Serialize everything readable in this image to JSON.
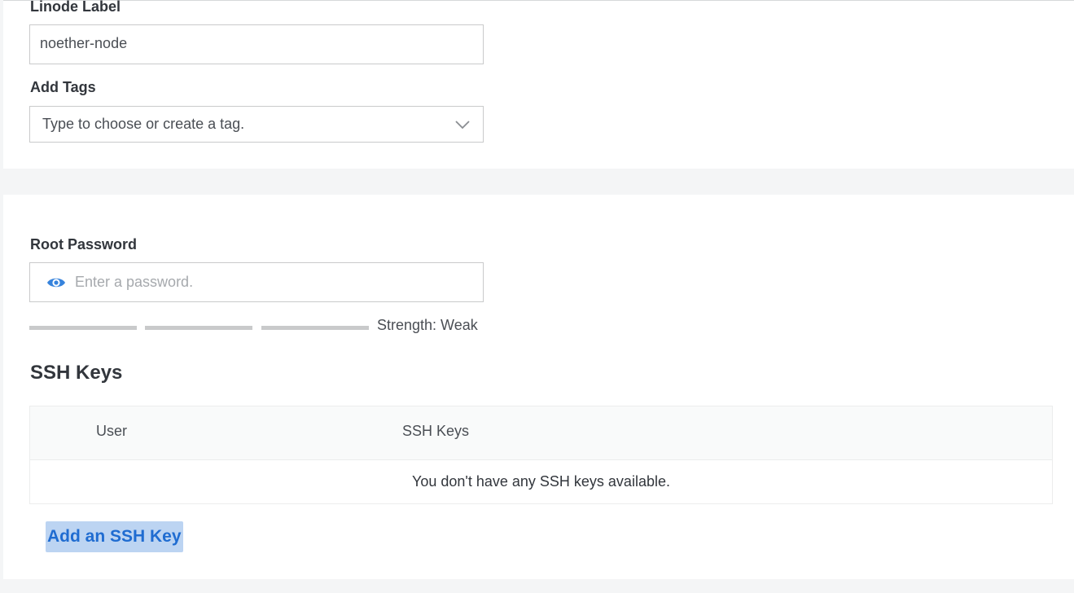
{
  "linode_label": {
    "label": "Linode Label",
    "value": "noether-node"
  },
  "tags": {
    "label": "Add Tags",
    "placeholder": "Type to choose or create a tag.",
    "icon": "chevron-down-icon"
  },
  "root_password": {
    "label": "Root Password",
    "placeholder": "Enter a password.",
    "icon": "eye-icon",
    "strength_text": "Strength: Weak",
    "strength_segments": 3,
    "strength_filled": 0
  },
  "ssh_keys": {
    "title": "SSH Keys",
    "columns": [
      "User",
      "SSH Keys"
    ],
    "empty_message": "You don't have any SSH keys available.",
    "add_button": "Add an SSH Key"
  },
  "colors": {
    "accent": "#3683dc",
    "link": "#1f6cd1",
    "highlight": "#bcd4f2"
  }
}
